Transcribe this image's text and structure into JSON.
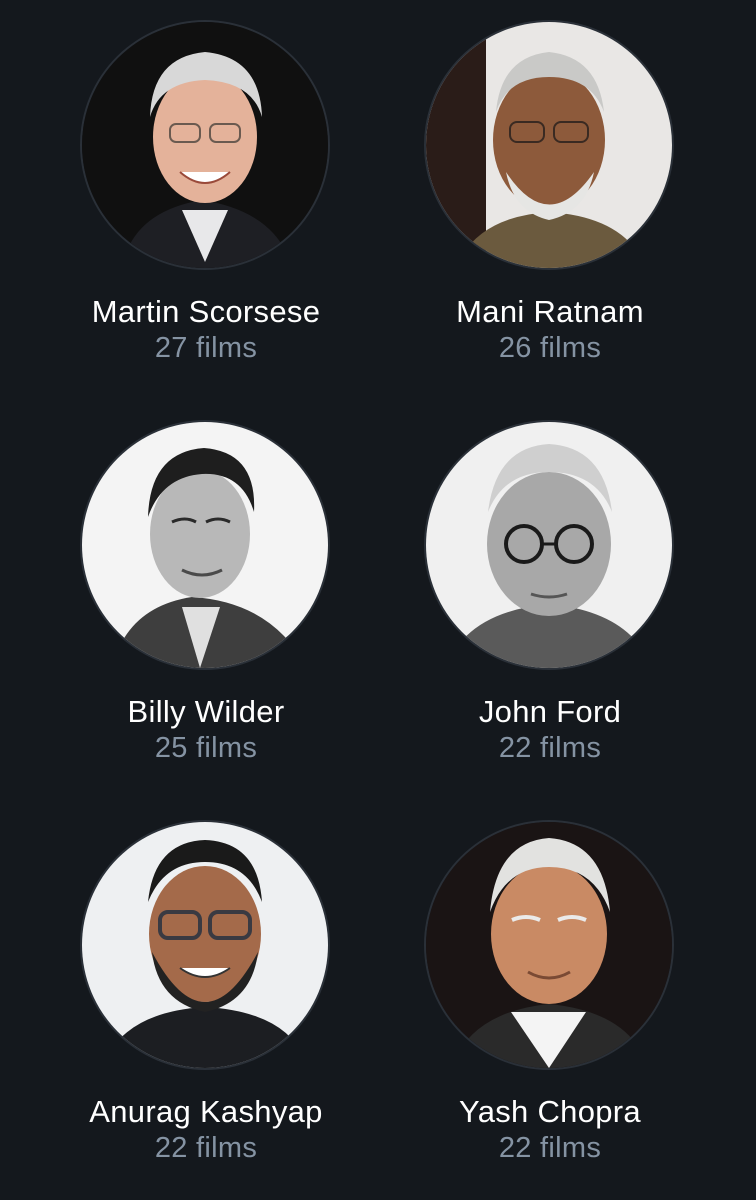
{
  "directors": [
    {
      "name": "Martin Scorsese",
      "count": "27 films",
      "photo": "portrait-color-dark-bg"
    },
    {
      "name": "Mani Ratnam",
      "count": "26 films",
      "photo": "portrait-color-light-bg"
    },
    {
      "name": "Billy Wilder",
      "count": "25 films",
      "photo": "portrait-bw-light-bg"
    },
    {
      "name": "John Ford",
      "count": "22 films",
      "photo": "portrait-bw-light-bg"
    },
    {
      "name": "Anurag Kashyap",
      "count": "22 films",
      "photo": "portrait-color-light-bg"
    },
    {
      "name": "Yash Chopra",
      "count": "22 films",
      "photo": "portrait-color-dark-bg"
    }
  ],
  "colors": {
    "background": "#14181d",
    "name_text": "#ffffff",
    "count_text": "#8593a3"
  }
}
